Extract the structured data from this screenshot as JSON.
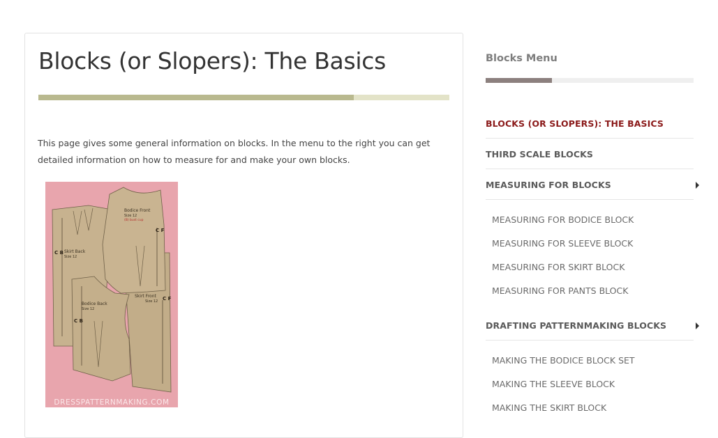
{
  "article": {
    "title": "Blocks (or Slopers): The Basics",
    "intro": "This page gives some general information on blocks.  In the menu to the right you can get detailed information on how to measure for and make your own blocks.",
    "image": {
      "watermark": "DRESSPATTERNMAKING.COM",
      "labels": {
        "bodice_front": "Bodice Front",
        "bodice_front_size": "Size 12",
        "bodice_front_note": "(B) bust cup",
        "skirt_back": "Skirt Back",
        "skirt_back_size": "Size 12",
        "bodice_back": "Bodice Back",
        "bodice_back_size": "Size 12",
        "skirt_front": "Skirt Front",
        "skirt_front_size": "Size 12",
        "cf": "C F",
        "cb": "C B"
      }
    }
  },
  "sidebar": {
    "title": "Blocks Menu",
    "items": [
      {
        "label": "BLOCKS (OR SLOPERS): THE BASICS",
        "active": true
      },
      {
        "label": "THIRD SCALE BLOCKS"
      },
      {
        "label": "MEASURING FOR BLOCKS",
        "has_submenu": true,
        "children": [
          "MEASURING FOR BODICE BLOCK",
          "MEASURING FOR SLEEVE BLOCK",
          "MEASURING FOR SKIRT BLOCK",
          "MEASURING FOR PANTS BLOCK"
        ]
      },
      {
        "label": "DRAFTING PATTERNMAKING BLOCKS",
        "has_submenu": true,
        "children": [
          "MAKING THE BODICE BLOCK SET",
          "MAKING THE SLEEVE BLOCK",
          "MAKING THE SKIRT BLOCK"
        ]
      }
    ]
  },
  "colors": {
    "accent_active": "#8b1a1a",
    "title_bar": "#b9b98f",
    "menu_bar": "#8c807e",
    "image_bg": "#e8a5ad",
    "pattern_paper": "#c4b08c"
  }
}
